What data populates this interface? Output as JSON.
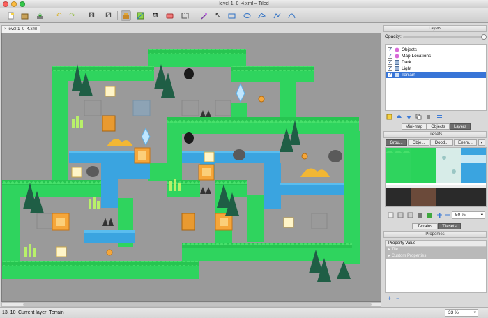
{
  "window": {
    "title": "level 1_0_4.xml – Tiled"
  },
  "toolbar": {
    "tools": [
      "new-icon",
      "open-icon",
      "save-icon",
      "undo-icon",
      "redo-icon",
      "random-mode-icon",
      "wang-mode-icon",
      "stamp-brush-icon",
      "terrain-brush-icon",
      "bucket-fill-icon",
      "eraser-icon",
      "rect-select-icon",
      "magic-wand-icon",
      "select-same-tile-icon",
      "select-objects-icon",
      "edit-polygons-icon",
      "insert-rectangle-icon",
      "insert-ellipse-icon",
      "insert-polygon-icon",
      "insert-polyline-icon",
      "insert-tile-icon"
    ]
  },
  "document": {
    "tab_label": "level 1_0_4.xml"
  },
  "layers_panel": {
    "title": "Layers",
    "opacity_label": "Opacity:",
    "layers": [
      {
        "name": "Objects",
        "type": "object"
      },
      {
        "name": "Map Locations",
        "type": "object"
      },
      {
        "name": "Dark",
        "type": "tile"
      },
      {
        "name": "Light",
        "type": "tile"
      },
      {
        "name": "Terrain",
        "type": "tile",
        "selected": true
      }
    ],
    "opacity": 1.0
  },
  "dock_tabs": [
    "Mini-map",
    "Objects",
    "Layers"
  ],
  "tilesets_panel": {
    "title": "Tilesets",
    "tabs": [
      "Grou...",
      "Obje...",
      "Dood...",
      "Enem..."
    ],
    "zoom": "50 %",
    "bottom_tabs": [
      "Terrains",
      "Tilesets"
    ]
  },
  "properties_panel": {
    "title": "Properties",
    "header": "Property  Value",
    "rows": [
      "Tile",
      "Custom Properties"
    ]
  },
  "statusbar": {
    "coords": "13, 10",
    "current_layer": "Current layer: Terrain",
    "zoom": "33 %"
  },
  "colors": {
    "selection": "#3875d7",
    "grass": "#2fd45e",
    "water": "#3aa4e0",
    "map_bg": "#9a9a9a"
  }
}
